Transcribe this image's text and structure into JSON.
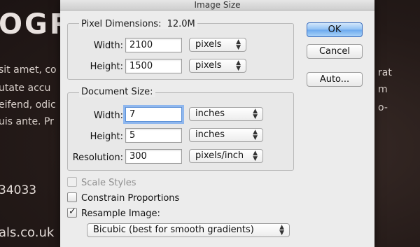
{
  "background": {
    "headline": "OGR",
    "lines": [
      "sit amet, co",
      "utate accu",
      "eifend, odic",
      "uis ante. Pr"
    ],
    "right_lines": [
      "rat",
      "m",
      "o-"
    ],
    "phone": "34033",
    "site": "als.co.uk"
  },
  "dialog": {
    "title": "Image Size",
    "pixel_dimensions": {
      "label": "Pixel Dimensions:",
      "size": "12.0M",
      "width_label": "Width:",
      "width_value": "2100",
      "width_unit": "pixels",
      "height_label": "Height:",
      "height_value": "1500",
      "height_unit": "pixels"
    },
    "document_size": {
      "label": "Document Size:",
      "width_label": "Width:",
      "width_value": "7",
      "width_unit": "inches",
      "height_label": "Height:",
      "height_value": "5",
      "height_unit": "inches",
      "resolution_label": "Resolution:",
      "resolution_value": "300",
      "resolution_unit": "pixels/inch"
    },
    "options": {
      "scale_styles": "Scale Styles",
      "constrain_proportions": "Constrain Proportions",
      "resample_image": "Resample Image:",
      "resample_method": "Bicubic (best for smooth gradients)"
    },
    "buttons": {
      "ok": "OK",
      "cancel": "Cancel",
      "auto": "Auto..."
    }
  }
}
